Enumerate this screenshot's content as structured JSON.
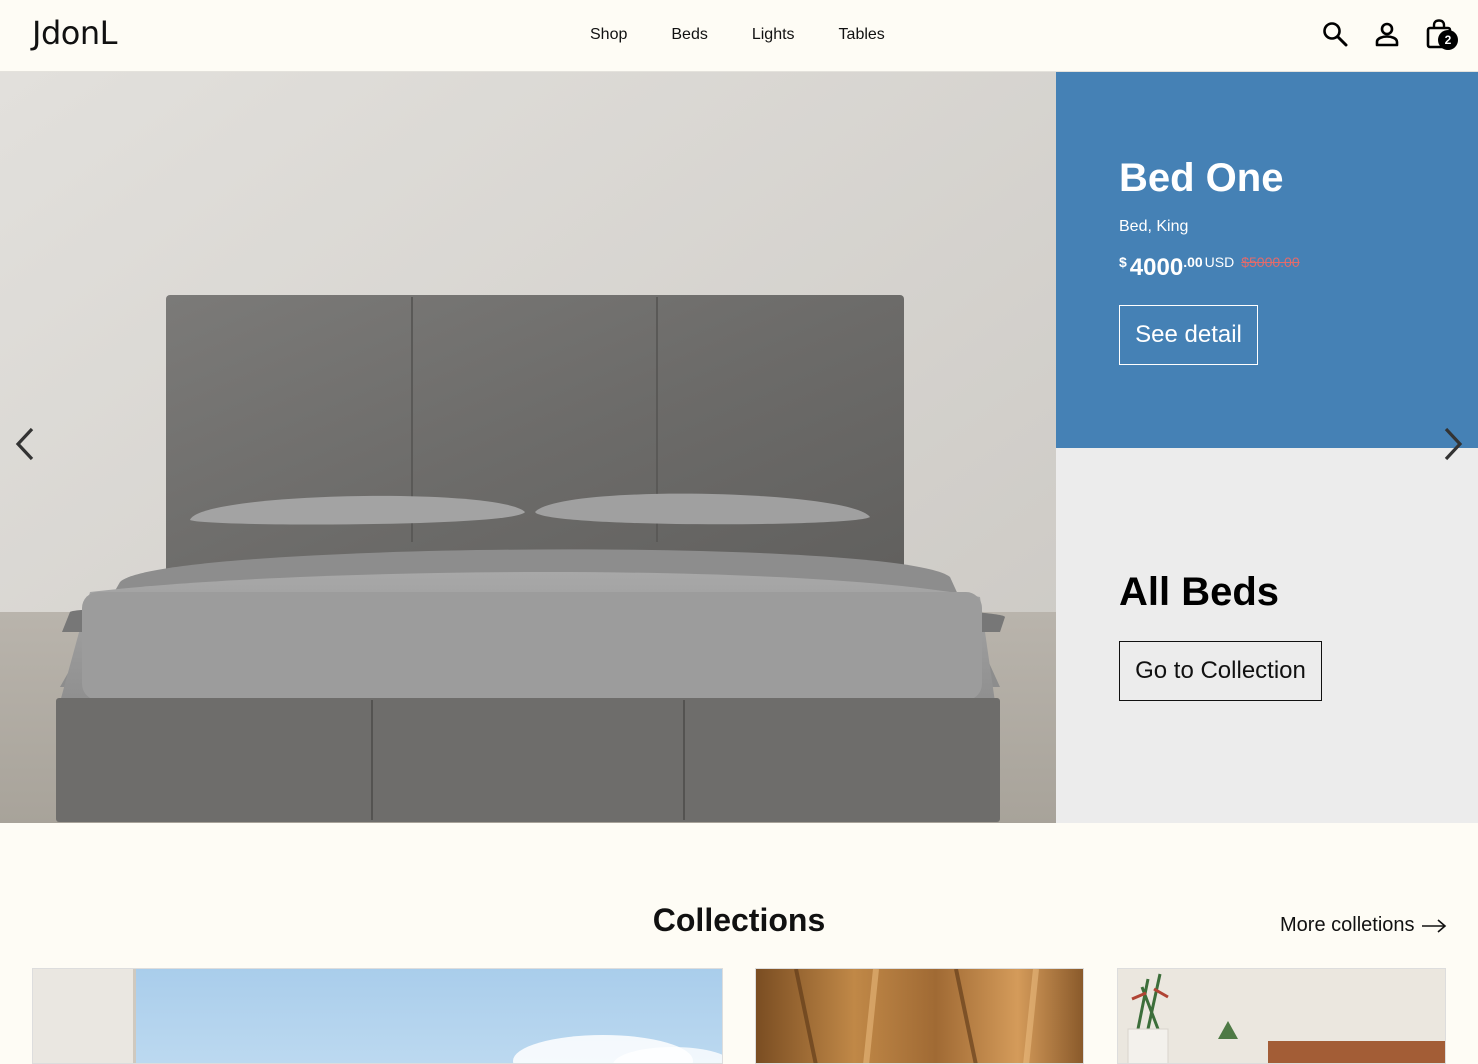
{
  "brand": {
    "logo": "JdonL"
  },
  "nav": {
    "items": [
      "Shop",
      "Beds",
      "Lights",
      "Tables"
    ]
  },
  "header": {
    "cart_count": "2",
    "icons": [
      "search-icon",
      "user-icon",
      "shopping-bag-icon"
    ]
  },
  "hero": {
    "product": {
      "title": "Bed One",
      "subtitle": "Bed, King",
      "price_currency": "$",
      "price_int": "4000",
      "price_dec": ".00",
      "price_code": "USD",
      "price_old": "$5000.00",
      "cta": "See detail"
    },
    "collection": {
      "title": "All Beds",
      "cta": "Go to Collection"
    },
    "colors": {
      "promo_bg": "#4581b5",
      "collection_bg": "#ececec",
      "old_price": "#e36b6b"
    }
  },
  "collections": {
    "heading": "Collections",
    "more_link": "More colletions"
  }
}
